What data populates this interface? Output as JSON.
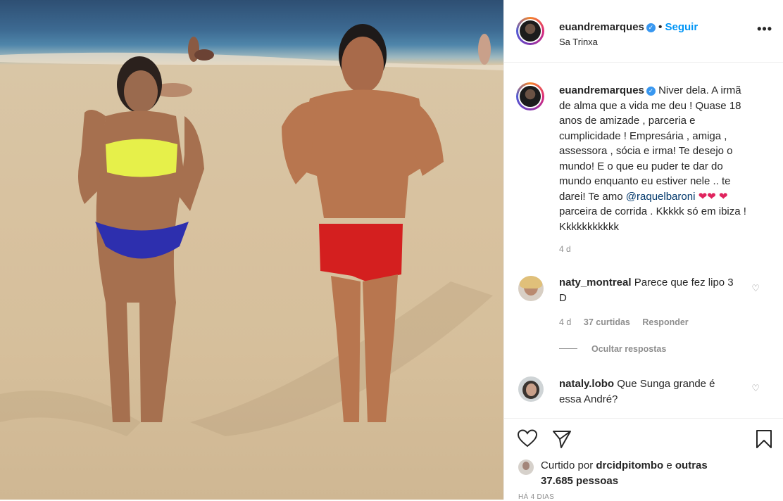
{
  "post": {
    "username": "euandremarques",
    "follow_label": "Seguir",
    "location": "Sa Trinxa",
    "more_label": "•••",
    "caption_text": "Niver dela. A irmã de alma que a vida me deu ! Quase 18 anos de amizade , parceria e cumplicidade ! Empresária , amiga , assessora , sócia e irma! Te desejo o mundo! E o que eu puder te dar do mundo enquanto eu estiver nele .. te darei! Te amo ",
    "caption_mention": "@raquelbaroni",
    "caption_tail": " parceira de corrida . Kkkkk só em ibiza ! Kkkkkkkkkkk",
    "caption_time": "4 d"
  },
  "comments": [
    {
      "username": "naty_montreal",
      "text": "Parece que fez lipo 3 D",
      "time": "4 d",
      "likes": "37 curtidas",
      "reply_label": "Responder"
    },
    {
      "username": "nataly.lobo",
      "text": "Que Sunga grande é essa André?"
    }
  ],
  "hide_replies_label": "Ocultar respostas",
  "footer": {
    "liked_prefix": "Curtido por ",
    "liked_user": "drcidpitombo",
    "liked_mid": " e ",
    "liked_others": "outras 37.685 pessoas",
    "date": "HÁ 4 DIAS"
  },
  "icons": {
    "verified": "verified-badge-icon",
    "like": "heart-icon",
    "share": "paper-plane-icon",
    "save": "bookmark-icon"
  },
  "colors": {
    "accent": "#0095f6",
    "verified": "#3897f0",
    "heart": "#e0245e"
  }
}
